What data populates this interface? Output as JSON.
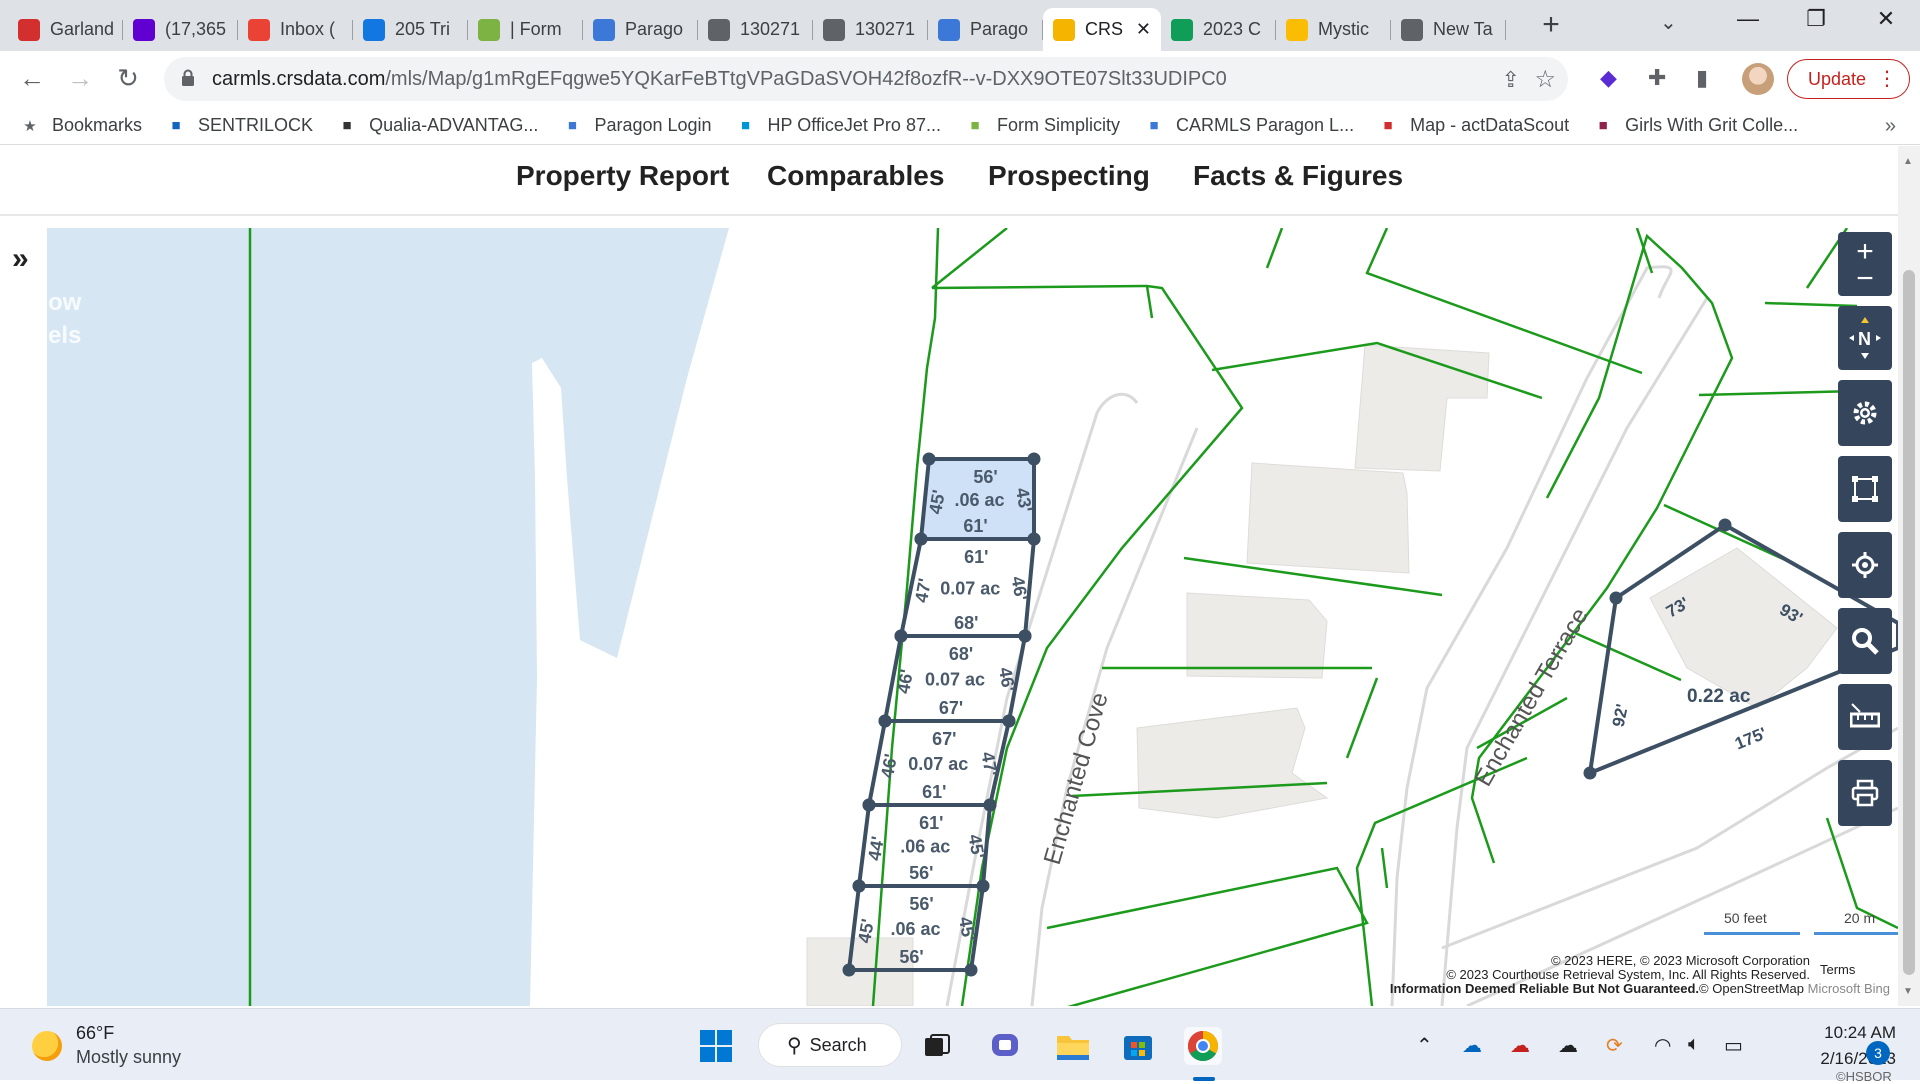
{
  "browser": {
    "tabs": [
      {
        "label": "Garland",
        "icon": "crs-logo-icon",
        "color": "#d32f2f"
      },
      {
        "label": "(17,365",
        "icon": "yahoo-mail-icon",
        "color": "#6001d2"
      },
      {
        "label": "Inbox (",
        "icon": "gmail-icon",
        "color": "#ea4335"
      },
      {
        "label": "205 Tri",
        "icon": "zillow-icon",
        "color": "#1277e1"
      },
      {
        "label": "| Form",
        "icon": "form-icon",
        "color": "#7cb342"
      },
      {
        "label": "Parago",
        "icon": "paragon-icon",
        "color": "#3c78d8"
      },
      {
        "label": "130271",
        "icon": "globe-icon",
        "color": "#5f6368"
      },
      {
        "label": "130271",
        "icon": "globe-icon",
        "color": "#5f6368"
      },
      {
        "label": "Parago",
        "icon": "paragon-icon",
        "color": "#3c78d8"
      },
      {
        "label": "CRS",
        "icon": "crs-map-icon",
        "color": "#f4b400",
        "active": true
      },
      {
        "label": "2023 C",
        "icon": "sheets-icon",
        "color": "#0f9d58"
      },
      {
        "label": "Mystic",
        "icon": "photos-icon",
        "color": "#fbbc04"
      },
      {
        "label": "New Ta",
        "icon": "chrome-icon",
        "color": "#5f6368"
      }
    ],
    "url_domain": "carmls.crsdata.com",
    "url_path": "/mls/Map/g1mRgEFqgwe5YQKarFeBTtgVPaGDaSVOH42f8ozfR--v-DXX9OTE07Slt33UDIPC0",
    "update_label": "Update",
    "bookmarks": [
      {
        "label": "Bookmarks",
        "icon": "star-icon",
        "color": "#5f6368"
      },
      {
        "label": "SENTRILOCK",
        "icon": "lock-box-icon",
        "color": "#1565c0"
      },
      {
        "label": "Qualia-ADVANTAG...",
        "icon": "qualia-icon",
        "color": "#333333"
      },
      {
        "label": "Paragon Login",
        "icon": "paragon-icon",
        "color": "#3c78d8"
      },
      {
        "label": "HP OfficeJet Pro 87...",
        "icon": "hp-icon",
        "color": "#0096d6"
      },
      {
        "label": "Form Simplicity",
        "icon": "form-icon",
        "color": "#7cb342"
      },
      {
        "label": "CARMLS Paragon L...",
        "icon": "paragon-icon",
        "color": "#3c78d8"
      },
      {
        "label": "Map - actDataScout",
        "icon": "crs-logo-icon",
        "color": "#d32f2f"
      },
      {
        "label": "Girls With Grit Colle...",
        "icon": "ggc-icon",
        "color": "#8e244d"
      }
    ]
  },
  "site_nav": {
    "items": [
      "Property Report",
      "Comparables",
      "Prospecting",
      "Facts & Figures"
    ]
  },
  "sidebar": {
    "partial_text_1": "ow",
    "partial_text_2": "els"
  },
  "map": {
    "street_labels": [
      "Enchanted Cove",
      "Enchanted Terrace"
    ],
    "parcels": [
      {
        "top": "56'",
        "area": ".06 ac",
        "bottom": "61'",
        "left": "45'",
        "right": "43'",
        "selected": true
      },
      {
        "top": "61'",
        "area": "0.07 ac",
        "bottom": "68'",
        "left": "47'",
        "right": "46'"
      },
      {
        "top": "68'",
        "area": "0.07 ac",
        "bottom": "67'",
        "left": "46'",
        "right": "46'"
      },
      {
        "top": "67'",
        "area": "0.07 ac",
        "bottom": "61'",
        "left": "46'",
        "right": "47'"
      },
      {
        "top": "61'",
        "area": ".06 ac",
        "bottom": "56'",
        "left": "44'",
        "right": "45'"
      },
      {
        "top": "56'",
        "area": ".06 ac",
        "bottom": "56'",
        "left": "45'",
        "right": "45'"
      }
    ],
    "corner_parcel": {
      "area": "0.22 ac",
      "dims": [
        "73'",
        "93'",
        "175'",
        "92'"
      ]
    },
    "scale_feet": "50 feet",
    "scale_m": "20 m",
    "terms_label": "Terms",
    "credits_line1": "© 2023 HERE, © 2023 Microsoft Corporation",
    "credits_line2": "© 2023 Courthouse Retrieval System, Inc. All Rights Reserved.",
    "credits_line3_bold": "Information Deemed Reliable But Not Guaranteed.",
    "credits_line3_rest": "© OpenStreetMap",
    "bing_label": "Microsoft Bing",
    "tools": [
      "zoom-in-icon",
      "compass-icon",
      "settings-icon",
      "select-area-icon",
      "locate-icon",
      "search-icon",
      "measure-icon",
      "print-icon"
    ],
    "colors": {
      "water": "#d6e6f3",
      "parcel_line": "#1c9a1c",
      "selected_outline": "#3d4f63",
      "selected_fill": "#cfe1f7",
      "tool_bg": "#35465c"
    }
  },
  "taskbar": {
    "temperature": "66°F",
    "weather": "Mostly sunny",
    "search_label": "Search",
    "time": "10:24 AM",
    "date": "2/16/2023",
    "notifications": "3",
    "watermark": "©HSBOR"
  }
}
